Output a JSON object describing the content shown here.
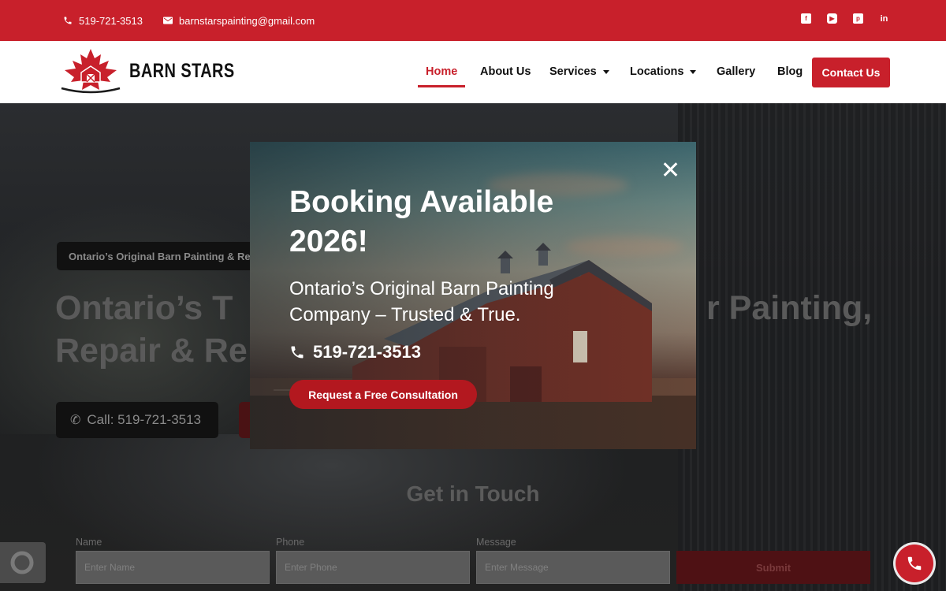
{
  "topbar": {
    "phone": "519-721-3513",
    "email": "barnstarspainting@gmail.com",
    "socials": [
      "facebook-icon",
      "youtube-icon",
      "pinterest-icon",
      "linkedin-icon"
    ]
  },
  "header": {
    "logo_text": "BARN STARS",
    "nav": {
      "home": "Home",
      "about": "About Us",
      "services": "Services",
      "locations": "Locations",
      "gallery": "Gallery",
      "blog": "Blog"
    },
    "contact_button": "Contact Us"
  },
  "hero": {
    "badge": "Ontario’s Original Barn Painting & Repair",
    "title_line1_left": "Ontario’s T",
    "title_line1_right": "r Painting,",
    "title_line2": "Repair & Re",
    "call_button": "Call: 519-721-3513"
  },
  "contact_form": {
    "title": "Get in Touch",
    "name_label": "Name",
    "name_placeholder": "Enter Name",
    "phone_label": "Phone",
    "phone_placeholder": "Enter Phone",
    "message_label": "Message",
    "message_placeholder": "Enter Message",
    "submit": "Submit"
  },
  "modal": {
    "title": "Booking Available 2026!",
    "subtitle": "Ontario’s Original Barn Painting Company – Trusted & True.",
    "phone": "519-721-3513",
    "cta": "Request a Free Consultation"
  },
  "colors": {
    "brand_red": "#c8202b",
    "dark_red": "#b3181f"
  }
}
